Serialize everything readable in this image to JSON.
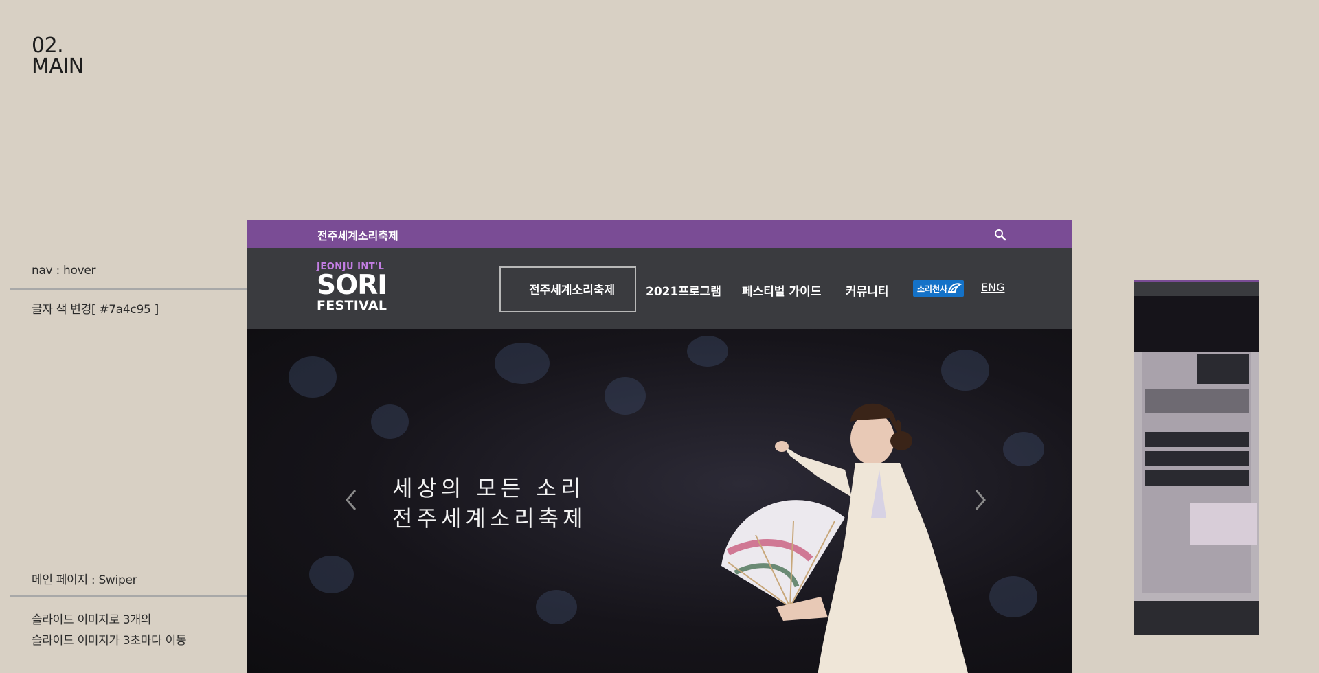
{
  "page_label": {
    "line1": "02.",
    "line2": "MAIN"
  },
  "annotations": {
    "nav_title": "nav : hover",
    "nav_desc": "글자 색 변경[ #7a4c95 ]",
    "swiper_title": "메인 페이지 : Swiper",
    "swiper_desc1": "슬라이드 이미지로 3개의",
    "swiper_desc2": "슬라이드 이미지가 3초마다 이동"
  },
  "topbar": {
    "title": "전주세계소리축제",
    "search_icon": "search-icon",
    "color": "#7a4c95"
  },
  "logo": {
    "line1": "JEONJU INT'L",
    "line2": "SORI",
    "line3": "FESTIVAL"
  },
  "nav": {
    "items": [
      {
        "label": "전주세계소리축제"
      },
      {
        "label": "2021프로그램"
      },
      {
        "label": "페스티벌 가이드"
      },
      {
        "label": "커뮤니티"
      }
    ],
    "badge": "소리천사",
    "eng": "ENG"
  },
  "hero": {
    "line1": "세상의 모든 소리",
    "line2": "전주세계소리축제"
  }
}
